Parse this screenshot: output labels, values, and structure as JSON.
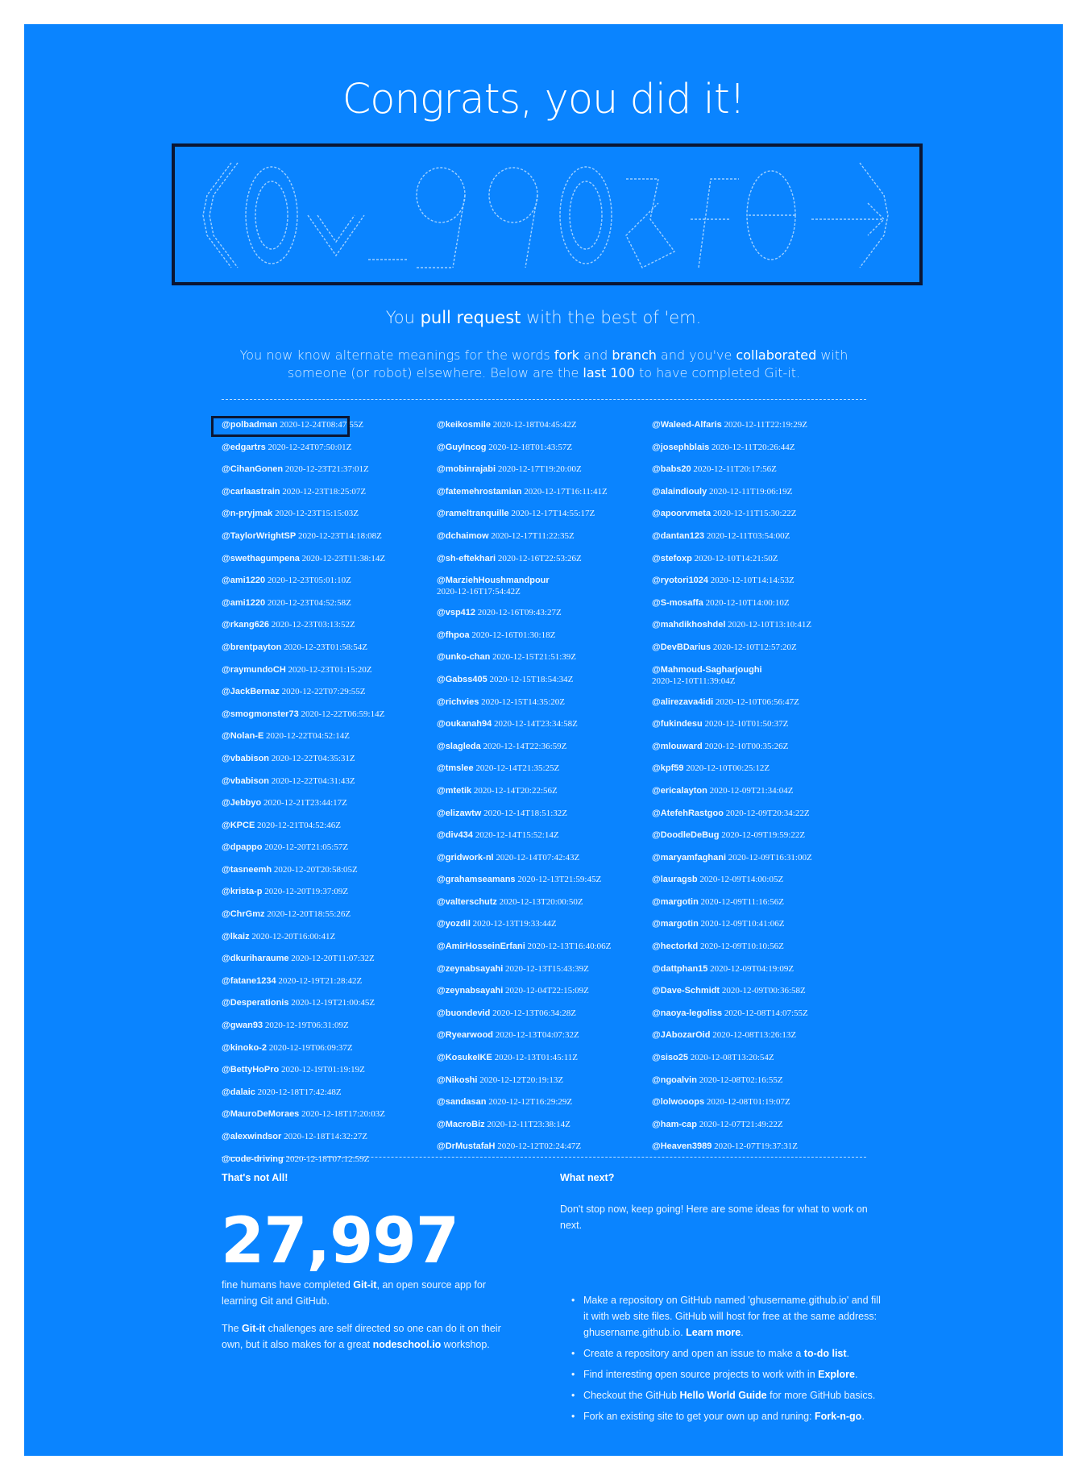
{
  "title": "Congrats, you did it!",
  "banner_alt": "ASCII art heading",
  "tagline": {
    "pre": "You ",
    "bold": "pull request",
    "post": " with the best of 'em."
  },
  "intro": {
    "p1": "You now know alternate meanings for the words ",
    "fork": "fork",
    "p2": " and ",
    "branch": "branch",
    "p3": " and you've ",
    "collab": "collaborated",
    "p4": " with someone (or robot) elsewhere. Below are the ",
    "last": "last 100",
    "p5": " to have completed Git-it."
  },
  "completers": {
    "col1": [
      {
        "user": "@polbadman",
        "time": "2020-12-24T08:47:55Z"
      },
      {
        "user": "@edgartrs",
        "time": "2020-12-24T07:50:01Z"
      },
      {
        "user": "@CihanGonen",
        "time": "2020-12-23T21:37:01Z"
      },
      {
        "user": "@carlaastrain",
        "time": "2020-12-23T18:25:07Z"
      },
      {
        "user": "@n-pryjmak",
        "time": "2020-12-23T15:15:03Z"
      },
      {
        "user": "@TaylorWrightSP",
        "time": "2020-12-23T14:18:08Z"
      },
      {
        "user": "@swethagumpena",
        "time": "2020-12-23T11:38:14Z"
      },
      {
        "user": "@ami1220",
        "time": "2020-12-23T05:01:10Z"
      },
      {
        "user": "@ami1220",
        "time": "2020-12-23T04:52:58Z"
      },
      {
        "user": "@rkang626",
        "time": "2020-12-23T03:13:52Z"
      },
      {
        "user": "@brentpayton",
        "time": "2020-12-23T01:58:54Z"
      },
      {
        "user": "@raymundoCH",
        "time": "2020-12-23T01:15:20Z"
      },
      {
        "user": "@JackBernaz",
        "time": "2020-12-22T07:29:55Z"
      },
      {
        "user": "@smogmonster73",
        "time": "2020-12-22T06:59:14Z"
      },
      {
        "user": "@Nolan-E",
        "time": "2020-12-22T04:52:14Z"
      },
      {
        "user": "@vbabison",
        "time": "2020-12-22T04:35:31Z"
      },
      {
        "user": "@vbabison",
        "time": "2020-12-22T04:31:43Z"
      },
      {
        "user": "@Jebbyo",
        "time": "2020-12-21T23:44:17Z"
      },
      {
        "user": "@KPCE",
        "time": "2020-12-21T04:52:46Z"
      },
      {
        "user": "@dpappo",
        "time": "2020-12-20T21:05:57Z"
      },
      {
        "user": "@tasneemh",
        "time": "2020-12-20T20:58:05Z"
      },
      {
        "user": "@krista-p",
        "time": "2020-12-20T19:37:09Z"
      },
      {
        "user": "@ChrGmz",
        "time": "2020-12-20T18:55:26Z"
      },
      {
        "user": "@lkaiz",
        "time": "2020-12-20T16:00:41Z"
      },
      {
        "user": "@dkuriharaume",
        "time": "2020-12-20T11:07:32Z"
      },
      {
        "user": "@fatane1234",
        "time": "2020-12-19T21:28:42Z"
      },
      {
        "user": "@Desperationis",
        "time": "2020-12-19T21:00:45Z"
      },
      {
        "user": "@gwan93",
        "time": "2020-12-19T06:31:09Z"
      },
      {
        "user": "@kinoko-2",
        "time": "2020-12-19T06:09:37Z"
      },
      {
        "user": "@BettyHoPro",
        "time": "2020-12-19T01:19:19Z"
      },
      {
        "user": "@dalaic",
        "time": "2020-12-18T17:42:48Z"
      },
      {
        "user": "@MauroDeMoraes",
        "time": "2020-12-18T17:20:03Z"
      },
      {
        "user": "@alexwindsor",
        "time": "2020-12-18T14:32:27Z"
      },
      {
        "user": "@code-driving",
        "time": "2020-12-18T07:12:59Z"
      }
    ],
    "col2": [
      {
        "user": "@keikosmile",
        "time": "2020-12-18T04:45:42Z"
      },
      {
        "user": "@GuyIncog",
        "time": "2020-12-18T01:43:57Z"
      },
      {
        "user": "@mobinrajabi",
        "time": "2020-12-17T19:20:00Z"
      },
      {
        "user": "@fatemehrostamian",
        "time": "2020-12-17T16:11:41Z"
      },
      {
        "user": "@rameltranquille",
        "time": "2020-12-17T14:55:17Z"
      },
      {
        "user": "@dchaimow",
        "time": "2020-12-17T11:22:35Z"
      },
      {
        "user": "@sh-eftekhari",
        "time": "2020-12-16T22:53:26Z"
      },
      {
        "user": "@MarziehHoushmandpour",
        "time": "2020-12-16T17:54:42Z",
        "wrap": true
      },
      {
        "user": "@vsp412",
        "time": "2020-12-16T09:43:27Z"
      },
      {
        "user": "@fhpoa",
        "time": "2020-12-16T01:30:18Z"
      },
      {
        "user": "@unko-chan",
        "time": "2020-12-15T21:51:39Z"
      },
      {
        "user": "@Gabss405",
        "time": "2020-12-15T18:54:34Z"
      },
      {
        "user": "@richvies",
        "time": "2020-12-15T14:35:20Z"
      },
      {
        "user": "@oukanah94",
        "time": "2020-12-14T23:34:58Z"
      },
      {
        "user": "@slagleda",
        "time": "2020-12-14T22:36:59Z"
      },
      {
        "user": "@tmslee",
        "time": "2020-12-14T21:35:25Z"
      },
      {
        "user": "@mtetik",
        "time": "2020-12-14T20:22:56Z"
      },
      {
        "user": "@elizawtw",
        "time": "2020-12-14T18:51:32Z"
      },
      {
        "user": "@div434",
        "time": "2020-12-14T15:52:14Z"
      },
      {
        "user": "@gridwork-nl",
        "time": "2020-12-14T07:42:43Z"
      },
      {
        "user": "@grahamseamans",
        "time": "2020-12-13T21:59:45Z"
      },
      {
        "user": "@valterschutz",
        "time": "2020-12-13T20:00:50Z"
      },
      {
        "user": "@yozdil",
        "time": "2020-12-13T19:33:44Z"
      },
      {
        "user": "@AmirHosseinErfani",
        "time": "2020-12-13T16:40:06Z"
      },
      {
        "user": "@zeynabsayahi",
        "time": "2020-12-13T15:43:39Z"
      },
      {
        "user": "@zeynabsayahi",
        "time": "2020-12-04T22:15:09Z"
      },
      {
        "user": "@buondevid",
        "time": "2020-12-13T06:34:28Z"
      },
      {
        "user": "@Ryearwood",
        "time": "2020-12-13T04:07:32Z"
      },
      {
        "user": "@KosukeIKE",
        "time": "2020-12-13T01:45:11Z"
      },
      {
        "user": "@Nikoshi",
        "time": "2020-12-12T20:19:13Z"
      },
      {
        "user": "@sandasan",
        "time": "2020-12-12T16:29:29Z"
      },
      {
        "user": "@MacroBiz",
        "time": "2020-12-11T23:38:14Z"
      },
      {
        "user": "@DrMustafaH",
        "time": "2020-12-12T02:24:47Z"
      }
    ],
    "col3": [
      {
        "user": "@Waleed-Alfaris",
        "time": "2020-12-11T22:19:29Z"
      },
      {
        "user": "@josephblais",
        "time": "2020-12-11T20:26:44Z"
      },
      {
        "user": "@babs20",
        "time": "2020-12-11T20:17:56Z"
      },
      {
        "user": "@alaindiouly",
        "time": "2020-12-11T19:06:19Z"
      },
      {
        "user": "@apoorvmeta",
        "time": "2020-12-11T15:30:22Z"
      },
      {
        "user": "@dantan123",
        "time": "2020-12-11T03:54:00Z"
      },
      {
        "user": "@stefoxp",
        "time": "2020-12-10T14:21:50Z"
      },
      {
        "user": "@ryotori1024",
        "time": "2020-12-10T14:14:53Z"
      },
      {
        "user": "@S-mosaffa",
        "time": "2020-12-10T14:00:10Z"
      },
      {
        "user": "@mahdikhoshdel",
        "time": "2020-12-10T13:10:41Z"
      },
      {
        "user": "@DevBDarius",
        "time": "2020-12-10T12:57:20Z"
      },
      {
        "user": "@Mahmoud-Sagharjoughi",
        "time": "2020-12-10T11:39:04Z",
        "wrap": true
      },
      {
        "user": "@alirezava4idi",
        "time": "2020-12-10T06:56:47Z"
      },
      {
        "user": "@fukindesu",
        "time": "2020-12-10T01:50:37Z"
      },
      {
        "user": "@mlouward",
        "time": "2020-12-10T00:35:26Z"
      },
      {
        "user": "@kpf59",
        "time": "2020-12-10T00:25:12Z"
      },
      {
        "user": "@ericalayton",
        "time": "2020-12-09T21:34:04Z"
      },
      {
        "user": "@AtefehRastgoo",
        "time": "2020-12-09T20:34:22Z"
      },
      {
        "user": "@DoodleDeBug",
        "time": "2020-12-09T19:59:22Z"
      },
      {
        "user": "@maryamfaghani",
        "time": "2020-12-09T16:31:00Z"
      },
      {
        "user": "@lauragsb",
        "time": "2020-12-09T14:00:05Z"
      },
      {
        "user": "@margotin",
        "time": "2020-12-09T11:16:56Z"
      },
      {
        "user": "@margotin",
        "time": "2020-12-09T10:41:06Z"
      },
      {
        "user": "@hectorkd",
        "time": "2020-12-09T10:10:56Z"
      },
      {
        "user": "@dattphan15",
        "time": "2020-12-09T04:19:09Z"
      },
      {
        "user": "@Dave-Schmidt",
        "time": "2020-12-09T00:36:58Z"
      },
      {
        "user": "@naoya-legoliss",
        "time": "2020-12-08T14:07:55Z"
      },
      {
        "user": "@JAbozarOid",
        "time": "2020-12-08T13:26:13Z"
      },
      {
        "user": "@siso25",
        "time": "2020-12-08T13:20:54Z"
      },
      {
        "user": "@ngoalvin",
        "time": "2020-12-08T02:16:55Z"
      },
      {
        "user": "@lolwooops",
        "time": "2020-12-08T01:19:07Z"
      },
      {
        "user": "@ham-cap",
        "time": "2020-12-07T21:49:22Z"
      },
      {
        "user": "@Heaven3989",
        "time": "2020-12-07T19:37:31Z"
      }
    ]
  },
  "stats": {
    "heading": "That's not All!",
    "count": "27,997",
    "p1a": "fine humans have completed ",
    "p1b": "Git-it",
    "p1c": ", an open source app for learning Git and GitHub.",
    "p2a": "The ",
    "p2b": "Git-it",
    "p2c": " challenges are self directed so one can do it on their own, but it also makes for a great ",
    "p2d": "nodeschool.io",
    "p2e": " workshop."
  },
  "next": {
    "heading": "What next?",
    "intro": "Don't stop now, keep going! Here are some ideas for what to work on next.",
    "items": [
      {
        "text": "Make a repository on GitHub named 'ghusername.github.io' and fill it with web site files. GitHub will host for free at the same address: ghusername.github.io. ",
        "link": "Learn more",
        "after": "."
      },
      {
        "text": "Create a repository and open an issue to make a ",
        "link": "to-do list",
        "after": "."
      },
      {
        "text": "Find interesting open source projects to work with in ",
        "link": "Explore",
        "after": "."
      },
      {
        "text": "Checkout the GitHub ",
        "link": "Hello World Guide",
        "after": " for more GitHub basics."
      },
      {
        "text": "Fork an existing site to get your own up and runing: ",
        "link": "Fork-n-go",
        "after": "."
      }
    ]
  },
  "colors": {
    "panel": "#0a84ff",
    "highlight_border": "#0b1633"
  }
}
